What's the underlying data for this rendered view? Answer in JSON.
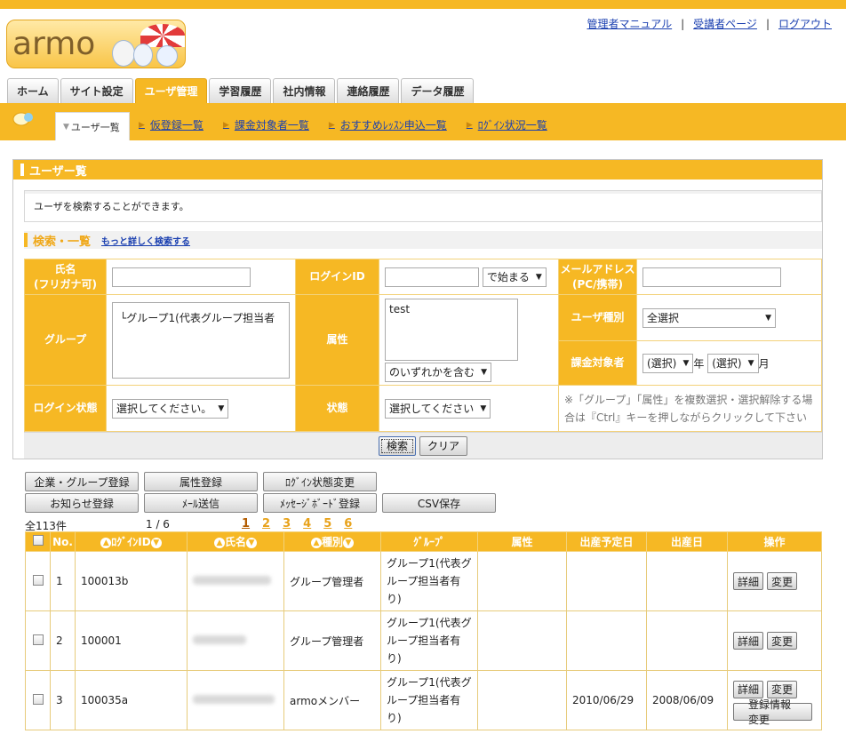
{
  "logo": {
    "text": "armo"
  },
  "header_links": [
    "管理者マニュアル",
    "受講者ページ",
    "ログアウト"
  ],
  "header_sep": "|",
  "tabs": [
    "ホーム",
    "サイト設定",
    "ユーザ管理",
    "学習履歴",
    "社内情報",
    "連絡履歴",
    "データ履歴"
  ],
  "subnav": {
    "active": "ユーザ一覧",
    "links": [
      "仮登録一覧",
      "課金対象者一覧",
      "おすすめﾚｯｽﾝ申込一覧",
      "ﾛｸﾞｲﾝ状況一覧"
    ]
  },
  "panel": {
    "title": "ユーザー覧",
    "description": "ユーザを検索することができます。",
    "search_title": "検索・一覧",
    "detail_link": "もっと詳しく検索する"
  },
  "search": {
    "name_label": "氏名\n(フリガナ可)",
    "login_label": "ログインID",
    "login_mode": "で始まる",
    "mail_label": "メールアドレス\n(PC/携帯)",
    "group_label": "グループ",
    "group_option": "└グループ1(代表グループ担当者",
    "attr_label": "属性",
    "attr_option": "test",
    "attr_mode": "のいずれかを含む",
    "usertype_label": "ユーザ種別",
    "usertype_value": "全選択",
    "billing_label": "課金対象者",
    "year_value": "(選択)",
    "year_unit": "年",
    "month_value": "(選択)",
    "month_unit": "月",
    "login_state_label": "ログイン状態",
    "login_state_value": "選択してください。",
    "state_label": "状態",
    "state_value": "選択してください",
    "note": "※「グループ」「属性」を複数選択・選択解除する場合は『Ctrl』キーを押しながらクリックして下さい",
    "search_button": "検索",
    "clear_button": "クリア"
  },
  "action_buttons": [
    "企業・グループ登録",
    "属性登録",
    "ﾛｸﾞｲﾝ状態変更",
    "お知らせ登録",
    "ﾒｰﾙ送信",
    "ﾒｯｾｰｼﾞﾎﾞｰﾄﾞ登録",
    "CSV保存"
  ],
  "list": {
    "count": "全113件",
    "page": "1 / 6",
    "pages": [
      "1",
      "2",
      "3",
      "4",
      "5",
      "6"
    ],
    "headers": [
      "No.",
      "ﾛｸﾞｲﾝID",
      "氏名",
      "種別",
      "ｸﾞﾙｰﾌﾟ",
      "属性",
      "出産予定日",
      "出産日",
      "操作"
    ],
    "rows": [
      {
        "no": "1",
        "login_id": "100013b",
        "type": "グループ管理者",
        "group": "グループ1(代表グループ担当者有り)",
        "attr": "",
        "due": "",
        "birth": ""
      },
      {
        "no": "2",
        "login_id": "100001",
        "type": "グループ管理者",
        "group": "グループ1(代表グループ担当者有り)",
        "attr": "",
        "due": "",
        "birth": ""
      },
      {
        "no": "3",
        "login_id": "100035a",
        "type": "armoメンバー",
        "group": "グループ1(代表グループ担当者有り)",
        "attr": "",
        "due": "2010/06/29",
        "birth": "2008/06/09"
      }
    ],
    "detail_button": "詳細",
    "change_button": "変更",
    "reg_change_button": "登録情報変更"
  }
}
